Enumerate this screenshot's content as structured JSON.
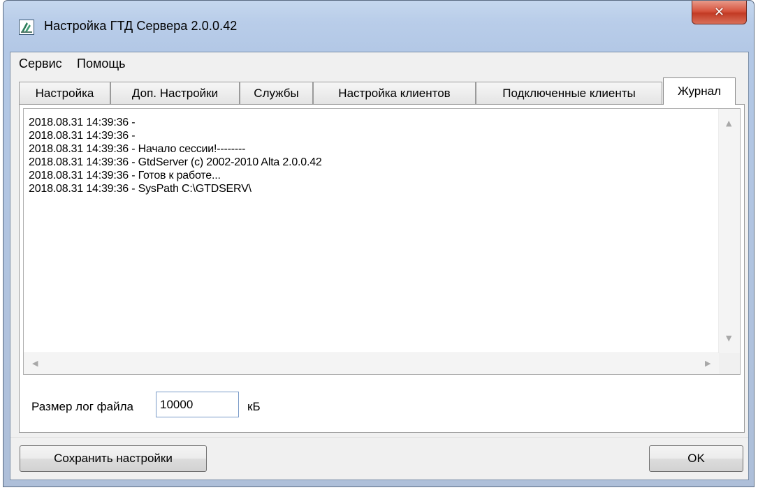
{
  "window": {
    "title": "Настройка ГТД Сервера 2.0.0.42",
    "close_glyph": "✕"
  },
  "menu": [
    "Сервис",
    "Помощь"
  ],
  "tabs": [
    {
      "label": "Настройка",
      "active": false
    },
    {
      "label": "Доп. Настройки",
      "active": false
    },
    {
      "label": "Службы",
      "active": false
    },
    {
      "label": "Настройка клиентов",
      "active": false
    },
    {
      "label": "Подключенные клиенты",
      "active": false
    },
    {
      "label": "Журнал",
      "active": true
    }
  ],
  "log": {
    "lines": [
      "2018.08.31 14:39:36 -",
      "2018.08.31 14:39:36 -",
      "2018.08.31 14:39:36 - Начало сессии!--------",
      "2018.08.31 14:39:36 - GtdServer (c) 2002-2010 Alta 2.0.0.42",
      "2018.08.31 14:39:36 - Готов к работе...",
      "2018.08.31 14:39:36 - SysPath C:\\GTDSERV\\"
    ]
  },
  "log_size": {
    "label": "Размер лог файла",
    "value": "10000",
    "unit": "кБ"
  },
  "buttons": {
    "save": "Сохранить настройки",
    "ok": "OK"
  },
  "colors": {
    "titlebar": "#b9cde9",
    "close_button": "#c23a24",
    "dialog_bg": "#f0f0f0"
  }
}
